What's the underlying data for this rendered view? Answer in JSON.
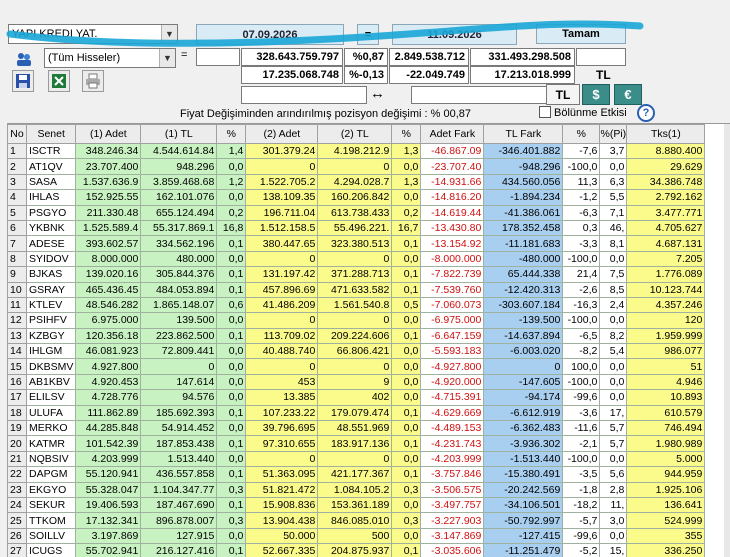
{
  "top": {
    "stock_combo": "YAPI KREDI YAT.",
    "start_date": "07.09.2026",
    "eq_symbol": "=",
    "end_date": "11.09.2026",
    "ok_button": "Tamam",
    "group_combo": "(Tüm Hisseler)",
    "eq_label": "=",
    "r1": [
      "328.643.759.797",
      "%0,87",
      "2.849.538.712",
      "331.493.298.508",
      ""
    ],
    "r2": [
      "17.235.068.748",
      "%-0,13",
      "-22.049.749",
      "17.213.018.999"
    ],
    "tl_label": "TL",
    "arrow": "↔",
    "tl_btn": "TL",
    "usd_btn": "$",
    "eur_btn": "€",
    "note": "Fiyat Değişiminden arındırılmış pozisyon değişimi : % 00,87",
    "split_checkbox": "Bölünme Etkisi",
    "help": "?"
  },
  "colors": {
    "green": "#c9f2c2",
    "yellow": "#fbfb8c",
    "blue": "#a9cff0",
    "red": "#d01010",
    "teal": "#3b8d8a"
  },
  "headers": [
    "No",
    "Senet",
    "(1) Adet",
    "(1) TL",
    "%",
    "(2) Adet",
    "(2) TL",
    "%",
    "Adet Fark",
    "TL Fark",
    "%",
    "%(Pi)",
    "Tks(1)"
  ],
  "rows": [
    [
      "1",
      "ISCTR",
      "348.246.34",
      "4.544.614.84",
      "1,4",
      "301.379.24",
      "4.198.212.9",
      "1,3",
      "-46.867.09",
      "-346.401.882",
      "-7,6",
      "3,7",
      "8.880.400"
    ],
    [
      "2",
      "AT1QV",
      "23.707.400",
      "948.296",
      "0,0",
      "0",
      "0",
      "0,0",
      "-23.707.40",
      "-948.296",
      "-100,0",
      "0,0",
      "29.629"
    ],
    [
      "3",
      "SASA",
      "1.537.636.9",
      "3.859.468.68",
      "1,2",
      "1.522.705.2",
      "4.294.028.7",
      "1,3",
      "-14.931.66",
      "434.560.056",
      "11,3",
      "6,3",
      "34.386.748"
    ],
    [
      "4",
      "IHLAS",
      "152.925.55",
      "162.101.076",
      "0,0",
      "138.109.35",
      "160.206.842",
      "0,0",
      "-14.816.20",
      "-1.894.234",
      "-1,2",
      "5,5",
      "2.792.162"
    ],
    [
      "5",
      "PSGYO",
      "211.330.48",
      "655.124.494",
      "0,2",
      "196.711.04",
      "613.738.433",
      "0,2",
      "-14.619.44",
      "-41.386.061",
      "-6,3",
      "7,1",
      "3.477.771"
    ],
    [
      "6",
      "YKBNK",
      "1.525.589.4",
      "55.317.869.1",
      "16,8",
      "1.512.158.5",
      "55.496.221.",
      "16,7",
      "-13.430.80",
      "178.352.458",
      "0,3",
      "46,",
      "4.705.627"
    ],
    [
      "7",
      "ADESE",
      "393.602.57",
      "334.562.196",
      "0,1",
      "380.447.65",
      "323.380.513",
      "0,1",
      "-13.154.92",
      "-11.181.683",
      "-3,3",
      "8,1",
      "4.687.131"
    ],
    [
      "8",
      "SYIDOV",
      "8.000.000",
      "480.000",
      "0,0",
      "0",
      "0",
      "0,0",
      "-8.000.000",
      "-480.000",
      "-100,0",
      "0,0",
      "7.205"
    ],
    [
      "9",
      "BJKAS",
      "139.020.16",
      "305.844.376",
      "0,1",
      "131.197.42",
      "371.288.713",
      "0,1",
      "-7.822.739",
      "65.444.338",
      "21,4",
      "7,5",
      "1.776.089"
    ],
    [
      "10",
      "GSRAY",
      "465.436.45",
      "484.053.894",
      "0,1",
      "457.896.69",
      "471.633.582",
      "0,1",
      "-7.539.760",
      "-12.420.313",
      "-2,6",
      "8,5",
      "10.123.744"
    ],
    [
      "11",
      "KTLEV",
      "48.546.282",
      "1.865.148.07",
      "0,6",
      "41.486.209",
      "1.561.540.8",
      "0,5",
      "-7.060.073",
      "-303.607.184",
      "-16,3",
      "2,4",
      "4.357.246"
    ],
    [
      "12",
      "PSIHFV",
      "6.975.000",
      "139.500",
      "0,0",
      "0",
      "0",
      "0,0",
      "-6.975.000",
      "-139.500",
      "-100,0",
      "0,0",
      "120"
    ],
    [
      "13",
      "KZBGY",
      "120.356.18",
      "223.862.500",
      "0,1",
      "113.709.02",
      "209.224.606",
      "0,1",
      "-6.647.159",
      "-14.637.894",
      "-6,5",
      "8,2",
      "1.959.999"
    ],
    [
      "14",
      "IHLGM",
      "46.081.923",
      "72.809.441",
      "0,0",
      "40.488.740",
      "66.806.421",
      "0,0",
      "-5.593.183",
      "-6.003.020",
      "-8,2",
      "5,4",
      "986.077"
    ],
    [
      "15",
      "DKBSMV",
      "4.927.800",
      "0",
      "0,0",
      "0",
      "0",
      "0,0",
      "-4.927.800",
      "0",
      "100,0",
      "0,0",
      "51"
    ],
    [
      "16",
      "AB1KBV",
      "4.920.453",
      "147.614",
      "0,0",
      "453",
      "9",
      "0,0",
      "-4.920.000",
      "-147.605",
      "-100,0",
      "0,0",
      "4.946"
    ],
    [
      "17",
      "ELILSV",
      "4.728.776",
      "94.576",
      "0,0",
      "13.385",
      "402",
      "0,0",
      "-4.715.391",
      "-94.174",
      "-99,6",
      "0,0",
      "10.893"
    ],
    [
      "18",
      "ULUFA",
      "111.862.89",
      "185.692.393",
      "0,1",
      "107.233.22",
      "179.079.474",
      "0,1",
      "-4.629.669",
      "-6.612.919",
      "-3,6",
      "17,",
      "610.579"
    ],
    [
      "19",
      "MERKO",
      "44.285.848",
      "54.914.452",
      "0,0",
      "39.796.695",
      "48.551.969",
      "0,0",
      "-4.489.153",
      "-6.362.483",
      "-11,6",
      "5,7",
      "746.494"
    ],
    [
      "20",
      "KATMR",
      "101.542.39",
      "187.853.438",
      "0,1",
      "97.310.655",
      "183.917.136",
      "0,1",
      "-4.231.743",
      "-3.936.302",
      "-2,1",
      "5,7",
      "1.980.989"
    ],
    [
      "21",
      "NQBSIV",
      "4.203.999",
      "1.513.440",
      "0,0",
      "0",
      "0",
      "0,0",
      "-4.203.999",
      "-1.513.440",
      "-100,0",
      "0,0",
      "5.000"
    ],
    [
      "22",
      "DAPGM",
      "55.120.941",
      "436.557.858",
      "0,1",
      "51.363.095",
      "421.177.367",
      "0,1",
      "-3.757.846",
      "-15.380.491",
      "-3,5",
      "5,6",
      "944.959"
    ],
    [
      "23",
      "EKGYO",
      "55.328.047",
      "1.104.347.77",
      "0,3",
      "51.821.472",
      "1.084.105.2",
      "0,3",
      "-3.506.575",
      "-20.242.569",
      "-1,8",
      "2,8",
      "1.925.106"
    ],
    [
      "24",
      "SEKUR",
      "19.406.593",
      "187.467.690",
      "0,1",
      "15.908.836",
      "153.361.189",
      "0,0",
      "-3.497.757",
      "-34.106.501",
      "-18,2",
      "11,",
      "136.641"
    ],
    [
      "25",
      "TTKOM",
      "17.132.341",
      "896.878.007",
      "0,3",
      "13.904.438",
      "846.085.010",
      "0,3",
      "-3.227.903",
      "-50.792.997",
      "-5,7",
      "3,0",
      "524.999"
    ],
    [
      "26",
      "SOILLV",
      "3.197.869",
      "127.915",
      "0,0",
      "50.000",
      "500",
      "0,0",
      "-3.147.869",
      "-127.415",
      "-99,6",
      "0,0",
      "355"
    ],
    [
      "27",
      "ICUGS",
      "55.702.941",
      "216.127.416",
      "0,1",
      "52.667.335",
      "204.875.937",
      "0,1",
      "-3.035.606",
      "-11.251.479",
      "-5,2",
      "15,",
      "336.250"
    ]
  ]
}
